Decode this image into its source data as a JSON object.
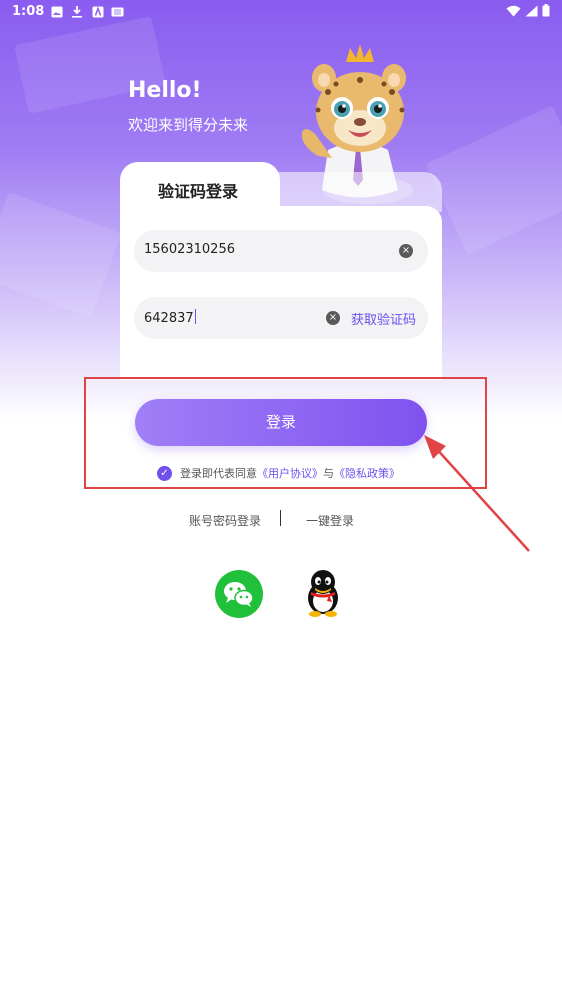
{
  "status_bar": {
    "time": "1:08"
  },
  "header": {
    "hello": "Hello!",
    "welcome": "欢迎来到得分未来"
  },
  "login_card": {
    "tab_title": "验证码登录",
    "phone_value": "15602310256",
    "code_value": "642837",
    "get_code_label": "获取验证码"
  },
  "actions": {
    "login_label": "登录",
    "agree_prefix": "登录即代表同意",
    "user_agreement": "《用户协议》",
    "and": "与",
    "privacy_policy": "《隐私政策》"
  },
  "alt_login": {
    "password_login": "账号密码登录",
    "one_click_login": "一键登录"
  },
  "social": [
    "wechat-icon",
    "qq-icon"
  ],
  "colors": {
    "accent": "#7f52ef",
    "annotation": "#e04444",
    "wechat": "#21c03a"
  }
}
